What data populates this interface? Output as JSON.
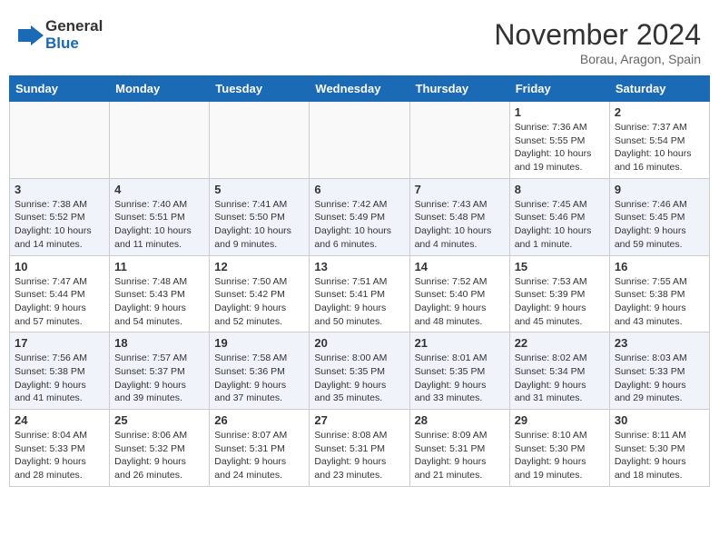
{
  "header": {
    "logo_line1": "General",
    "logo_line2": "Blue",
    "month": "November 2024",
    "location": "Borau, Aragon, Spain"
  },
  "weekdays": [
    "Sunday",
    "Monday",
    "Tuesday",
    "Wednesday",
    "Thursday",
    "Friday",
    "Saturday"
  ],
  "weeks": [
    [
      {
        "day": "",
        "info": ""
      },
      {
        "day": "",
        "info": ""
      },
      {
        "day": "",
        "info": ""
      },
      {
        "day": "",
        "info": ""
      },
      {
        "day": "",
        "info": ""
      },
      {
        "day": "1",
        "info": "Sunrise: 7:36 AM\nSunset: 5:55 PM\nDaylight: 10 hours and 19 minutes."
      },
      {
        "day": "2",
        "info": "Sunrise: 7:37 AM\nSunset: 5:54 PM\nDaylight: 10 hours and 16 minutes."
      }
    ],
    [
      {
        "day": "3",
        "info": "Sunrise: 7:38 AM\nSunset: 5:52 PM\nDaylight: 10 hours and 14 minutes."
      },
      {
        "day": "4",
        "info": "Sunrise: 7:40 AM\nSunset: 5:51 PM\nDaylight: 10 hours and 11 minutes."
      },
      {
        "day": "5",
        "info": "Sunrise: 7:41 AM\nSunset: 5:50 PM\nDaylight: 10 hours and 9 minutes."
      },
      {
        "day": "6",
        "info": "Sunrise: 7:42 AM\nSunset: 5:49 PM\nDaylight: 10 hours and 6 minutes."
      },
      {
        "day": "7",
        "info": "Sunrise: 7:43 AM\nSunset: 5:48 PM\nDaylight: 10 hours and 4 minutes."
      },
      {
        "day": "8",
        "info": "Sunrise: 7:45 AM\nSunset: 5:46 PM\nDaylight: 10 hours and 1 minute."
      },
      {
        "day": "9",
        "info": "Sunrise: 7:46 AM\nSunset: 5:45 PM\nDaylight: 9 hours and 59 minutes."
      }
    ],
    [
      {
        "day": "10",
        "info": "Sunrise: 7:47 AM\nSunset: 5:44 PM\nDaylight: 9 hours and 57 minutes."
      },
      {
        "day": "11",
        "info": "Sunrise: 7:48 AM\nSunset: 5:43 PM\nDaylight: 9 hours and 54 minutes."
      },
      {
        "day": "12",
        "info": "Sunrise: 7:50 AM\nSunset: 5:42 PM\nDaylight: 9 hours and 52 minutes."
      },
      {
        "day": "13",
        "info": "Sunrise: 7:51 AM\nSunset: 5:41 PM\nDaylight: 9 hours and 50 minutes."
      },
      {
        "day": "14",
        "info": "Sunrise: 7:52 AM\nSunset: 5:40 PM\nDaylight: 9 hours and 48 minutes."
      },
      {
        "day": "15",
        "info": "Sunrise: 7:53 AM\nSunset: 5:39 PM\nDaylight: 9 hours and 45 minutes."
      },
      {
        "day": "16",
        "info": "Sunrise: 7:55 AM\nSunset: 5:38 PM\nDaylight: 9 hours and 43 minutes."
      }
    ],
    [
      {
        "day": "17",
        "info": "Sunrise: 7:56 AM\nSunset: 5:38 PM\nDaylight: 9 hours and 41 minutes."
      },
      {
        "day": "18",
        "info": "Sunrise: 7:57 AM\nSunset: 5:37 PM\nDaylight: 9 hours and 39 minutes."
      },
      {
        "day": "19",
        "info": "Sunrise: 7:58 AM\nSunset: 5:36 PM\nDaylight: 9 hours and 37 minutes."
      },
      {
        "day": "20",
        "info": "Sunrise: 8:00 AM\nSunset: 5:35 PM\nDaylight: 9 hours and 35 minutes."
      },
      {
        "day": "21",
        "info": "Sunrise: 8:01 AM\nSunset: 5:35 PM\nDaylight: 9 hours and 33 minutes."
      },
      {
        "day": "22",
        "info": "Sunrise: 8:02 AM\nSunset: 5:34 PM\nDaylight: 9 hours and 31 minutes."
      },
      {
        "day": "23",
        "info": "Sunrise: 8:03 AM\nSunset: 5:33 PM\nDaylight: 9 hours and 29 minutes."
      }
    ],
    [
      {
        "day": "24",
        "info": "Sunrise: 8:04 AM\nSunset: 5:33 PM\nDaylight: 9 hours and 28 minutes."
      },
      {
        "day": "25",
        "info": "Sunrise: 8:06 AM\nSunset: 5:32 PM\nDaylight: 9 hours and 26 minutes."
      },
      {
        "day": "26",
        "info": "Sunrise: 8:07 AM\nSunset: 5:31 PM\nDaylight: 9 hours and 24 minutes."
      },
      {
        "day": "27",
        "info": "Sunrise: 8:08 AM\nSunset: 5:31 PM\nDaylight: 9 hours and 23 minutes."
      },
      {
        "day": "28",
        "info": "Sunrise: 8:09 AM\nSunset: 5:31 PM\nDaylight: 9 hours and 21 minutes."
      },
      {
        "day": "29",
        "info": "Sunrise: 8:10 AM\nSunset: 5:30 PM\nDaylight: 9 hours and 19 minutes."
      },
      {
        "day": "30",
        "info": "Sunrise: 8:11 AM\nSunset: 5:30 PM\nDaylight: 9 hours and 18 minutes."
      }
    ]
  ]
}
